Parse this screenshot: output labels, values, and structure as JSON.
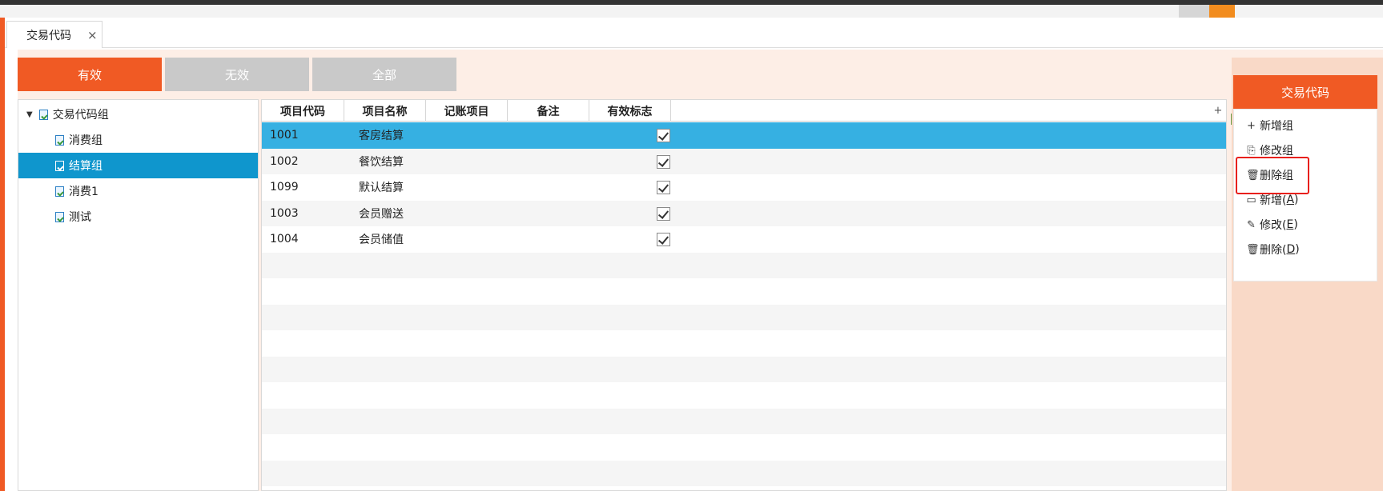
{
  "window": {
    "tab_label": "交易代码",
    "tab_close": "×"
  },
  "filters": [
    {
      "label": "有效",
      "active": true
    },
    {
      "label": "无效",
      "active": false
    },
    {
      "label": "全部",
      "active": false
    }
  ],
  "tree": {
    "root": "交易代码组",
    "root_arrow": "▼",
    "items": [
      {
        "label": "消费组",
        "selected": false
      },
      {
        "label": "结算组",
        "selected": true
      },
      {
        "label": "消费1",
        "selected": false
      },
      {
        "label": "测试",
        "selected": false
      }
    ]
  },
  "grid": {
    "columns": [
      "项目代码",
      "项目名称",
      "记账项目",
      "备注",
      "有效标志"
    ],
    "add_column": "+",
    "rows": [
      {
        "code": "1001",
        "name": "客房结算",
        "account": "",
        "note": "",
        "valid": true,
        "selected": true
      },
      {
        "code": "1002",
        "name": "餐饮结算",
        "account": "",
        "note": "",
        "valid": true,
        "selected": false
      },
      {
        "code": "1099",
        "name": "默认结算",
        "account": "",
        "note": "",
        "valid": true,
        "selected": false
      },
      {
        "code": "1003",
        "name": "会员赠送",
        "account": "",
        "note": "",
        "valid": true,
        "selected": false
      },
      {
        "code": "1004",
        "name": "会员储值",
        "account": "",
        "note": "",
        "valid": true,
        "selected": false
      }
    ]
  },
  "right_panel": {
    "title": "交易代码",
    "menu": [
      {
        "icon": "plus-icon",
        "glyph": "+",
        "label": "新增组",
        "key": ""
      },
      {
        "icon": "edit-doc-icon",
        "glyph": "⎘",
        "label": "修改组",
        "key": ""
      },
      {
        "icon": "trash-icon",
        "glyph": "🗑",
        "label": "删除组",
        "key": ""
      },
      {
        "icon": "new-doc-icon",
        "glyph": "▭",
        "label": "新增(",
        "key": "A",
        "suffix": ")"
      },
      {
        "icon": "pencil-icon",
        "glyph": "✎",
        "label": "修改(",
        "key": "E",
        "suffix": ")"
      },
      {
        "icon": "trash-icon",
        "glyph": "🗑",
        "label": "删除(",
        "key": "D",
        "suffix": ")"
      }
    ]
  },
  "colors": {
    "accent": "#f05a24",
    "selection": "#0f96cd",
    "row_selection": "#36b0e2",
    "highlight_box": "#e8201c"
  }
}
